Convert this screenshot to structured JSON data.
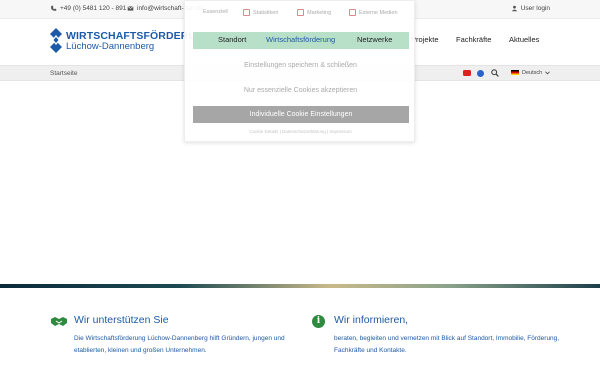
{
  "topbar": {
    "phone": "+49 (0) 5481 120 - 891",
    "email": "info@wirtschaft-dan.de",
    "login": "User login"
  },
  "logo": {
    "line1": "WIRTSCHAFTSFÖRDERUNG",
    "line2": "Lüchow-Dannenberg"
  },
  "nav": {
    "items": [
      "Standort",
      "Wirtschaftsförderung",
      "Netzwerke",
      "Projekte",
      "Fachkräfte",
      "Aktuelles"
    ]
  },
  "breadcrumb": {
    "label": "Startseite",
    "language": "Deutsch"
  },
  "cookie": {
    "categories": [
      "Essenziell",
      "Statistiken",
      "Marketing",
      "Externe Medien"
    ],
    "save_label": "Einstellungen speichern & schließen",
    "essential_label": "Nur essenzielle Cookies akzeptieren",
    "individual_label": "Individuelle Cookie Einstellungen",
    "footer_links": [
      "Cookie Details",
      "Datenschutzerklärung",
      "Impressum"
    ]
  },
  "sections": {
    "left": {
      "title": "Wir unterstützen Sie",
      "text": "Die Wirtschaftsförderung Lüchow-Dannenberg hilft Gründern, jungen und etablierten, kleinen und großen Unternehmen."
    },
    "right": {
      "title": "Wir informieren,",
      "text": "beraten, begleiten und vernetzen mit Blick auf Standort, Immobilie, Förderung, Fachkräfte und Kontakte."
    }
  },
  "colors": {
    "brand_blue": "#1d5aa8",
    "accent_green": "#2e8a3e",
    "youtube_red": "#e02020",
    "facebook_blue": "#2d62c8"
  },
  "icons": [
    "phone-icon",
    "mail-icon",
    "user-icon",
    "youtube-icon",
    "facebook-icon",
    "search-icon",
    "flag-icon",
    "chevron-down-icon",
    "handshake-icon",
    "info-icon"
  ]
}
